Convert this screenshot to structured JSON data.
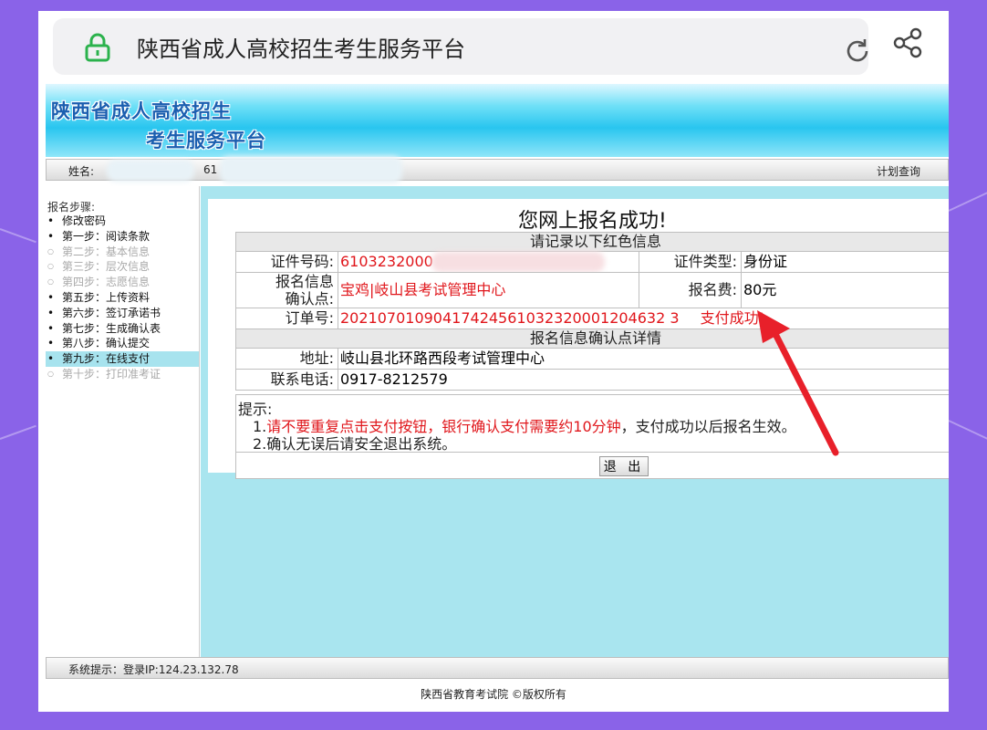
{
  "browser": {
    "page_title": "陕西省成人高校招生考生服务平台",
    "icons": {
      "lock": "lock-icon",
      "reload": "reload-icon",
      "share": "share-icon"
    }
  },
  "banner": {
    "line1": "陕西省成人高校招生",
    "line2": "考生服务平台"
  },
  "userbar": {
    "name_label": "姓名:",
    "id_prefix": "61",
    "plan_link": "计划查询"
  },
  "sidebar": {
    "title": "报名步骤:",
    "steps": [
      {
        "label": "修改密码",
        "state": "done"
      },
      {
        "label": "第一步：阅读条款",
        "state": "done"
      },
      {
        "label": "第二步：基本信息",
        "state": "disabled"
      },
      {
        "label": "第三步：层次信息",
        "state": "disabled"
      },
      {
        "label": "第四步：志愿信息",
        "state": "disabled"
      },
      {
        "label": "第五步：上传资料",
        "state": "done"
      },
      {
        "label": "第六步：签订承诺书",
        "state": "done"
      },
      {
        "label": "第七步：生成确认表",
        "state": "done"
      },
      {
        "label": "第八步：确认提交",
        "state": "done"
      },
      {
        "label": "第九步：在线支付",
        "state": "active"
      },
      {
        "label": "第十步：打印准考证",
        "state": "disabled"
      }
    ]
  },
  "main": {
    "success_title": "您网上报名成功!",
    "record_header": "请记录以下红色信息",
    "id_number_label": "证件号码:",
    "id_number_value": "6103232000",
    "id_type_label": "证件类型:",
    "id_type_value": "身份证",
    "confirm_point_label_1": "报名信息",
    "confirm_point_label_2": "确认点:",
    "confirm_point_value": "宝鸡|岐山县考试管理中心",
    "fee_label": "报名费:",
    "fee_value": "80元",
    "order_label": "订单号:",
    "order_value": "20210701090417424561032320001204632 3",
    "payment_status": "支付成功!",
    "detail_header": "报名信息确认点详情",
    "address_label": "地址:",
    "address_value": "岐山县北环路西段考试管理中心",
    "phone_label": "联系电话:",
    "phone_value": "0917-8212579",
    "tips_title": "提示:",
    "tip1_prefix": "1.",
    "tip1_red": "请不要重复点击支付按钮，银行确认支付需要约10分钟",
    "tip1_rest": "，支付成功以后报名生效。",
    "tip2": "2.确认无误后请安全退出系统。",
    "exit_button": "退 出"
  },
  "footer": {
    "system_tip": "系统提示：登录IP:124.23.132.78",
    "copyright": "陕西省教育考试院 ©版权所有"
  },
  "colors": {
    "accent_red": "#e0161b",
    "arrow_red": "#e8202a",
    "frame_purple": "#8a63e8",
    "content_bg": "#a9e5ef"
  }
}
